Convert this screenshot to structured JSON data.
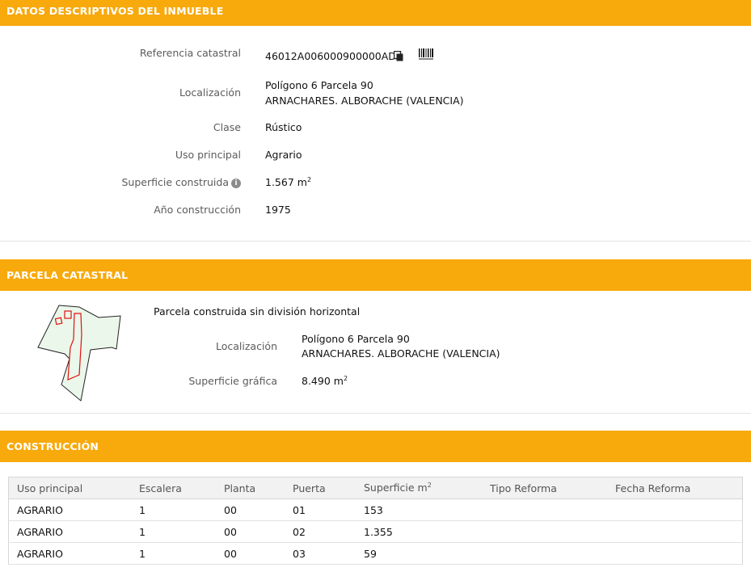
{
  "datos": {
    "header": "DATOS DESCRIPTIVOS DEL INMUEBLE",
    "referencia_label": "Referencia catastral",
    "referencia_value": "46012A006000900000AD",
    "localizacion_label": "Localización",
    "localizacion_line1": "Polígono 6 Parcela 90",
    "localizacion_line2": "ARNACHARES. ALBORACHE (VALENCIA)",
    "clase_label": "Clase",
    "clase_value": "Rústico",
    "uso_label": "Uso principal",
    "uso_value": "Agrario",
    "superficie_label": "Superficie construida",
    "superficie_value": "1.567 m",
    "anio_label": "Año construcción",
    "anio_value": "1975"
  },
  "parcela": {
    "header": "PARCELA CATASTRAL",
    "descripcion": "Parcela construida sin división horizontal",
    "localizacion_label": "Localización",
    "localizacion_line1": "Polígono 6 Parcela 90",
    "localizacion_line2": "ARNACHARES. ALBORACHE (VALENCIA)",
    "superficie_label": "Superficie gráfica",
    "superficie_value": "8.490 m"
  },
  "construccion": {
    "header": "CONSTRUCCIÓN",
    "columns": [
      "Uso principal",
      "Escalera",
      "Planta",
      "Puerta",
      "Superficie m",
      "Tipo Reforma",
      "Fecha Reforma"
    ],
    "rows": [
      [
        "AGRARIO",
        "1",
        "00",
        "01",
        "153",
        "",
        ""
      ],
      [
        "AGRARIO",
        "1",
        "00",
        "02",
        "1.355",
        "",
        ""
      ],
      [
        "AGRARIO",
        "1",
        "00",
        "03",
        "59",
        "",
        ""
      ]
    ]
  },
  "icons": {
    "copy": "copy-icon",
    "barcode": "barcode-icon",
    "info": "info-icon"
  },
  "colors": {
    "accent": "#f8a90b",
    "parcel_fill": "#eaf7ea",
    "building_outline": "#e01010"
  }
}
